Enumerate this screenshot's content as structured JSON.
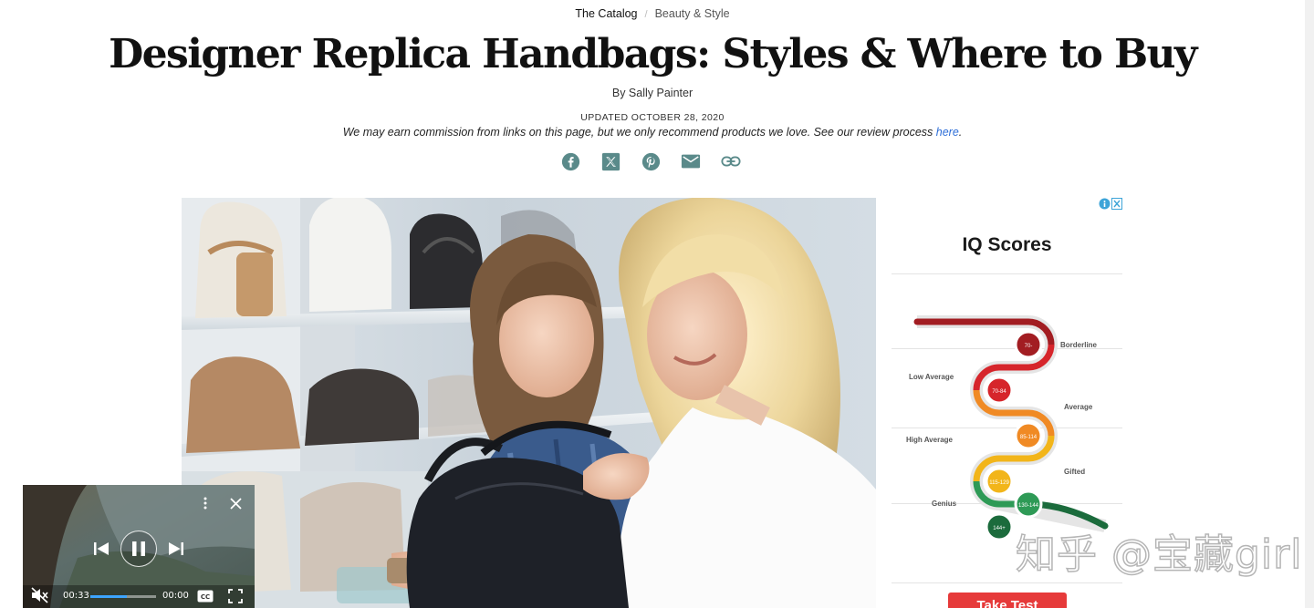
{
  "breadcrumb": {
    "primary": "The Catalog",
    "separator": "/",
    "secondary": "Beauty & Style"
  },
  "article": {
    "title": "Designer Replica Handbags: Styles & Where to Buy",
    "byline": "By Sally Painter",
    "updated": "UPDATED OCTOBER 28, 2020",
    "disclaimer_text": "We may earn commission from links on this page, but we only recommend products we love. See our review process ",
    "disclaimer_link": "here",
    "disclaimer_end": "."
  },
  "share": {
    "icons": [
      "facebook-icon",
      "x-icon",
      "pinterest-icon",
      "email-icon",
      "link-icon"
    ],
    "color": "#5a8a8a"
  },
  "ad": {
    "title": "IQ Scores",
    "labels": {
      "borderline": "Borderline",
      "low_average": "Low Average",
      "average": "Average",
      "high_average": "High Average",
      "gifted": "Gifted",
      "genius": "Genius"
    },
    "bubbles": [
      "70-",
      "70-84",
      "85-114",
      "115-129",
      "130-144",
      "144+"
    ],
    "cta": "Take Test",
    "badge_icon": "ad-choices-icon"
  },
  "watermark": "知乎 @宝藏girl",
  "video": {
    "current_time": "00:33",
    "duration": "00:00",
    "progress_fraction": 0.55,
    "icons": [
      "mute-icon",
      "previous-icon",
      "pause-icon",
      "next-icon",
      "more-options-icon",
      "close-icon",
      "captions-icon",
      "fullscreen-icon"
    ]
  }
}
